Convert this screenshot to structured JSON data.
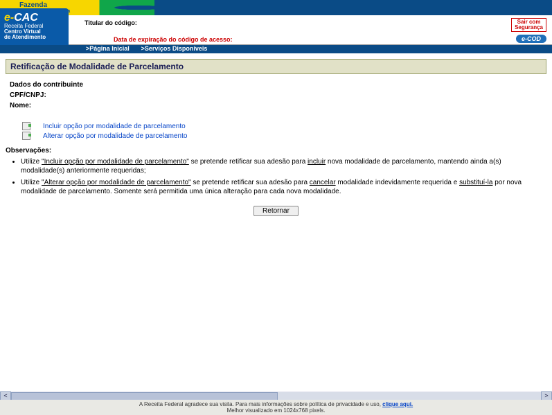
{
  "brand": {
    "name": "Fazenda",
    "sub": "Ministério da Fazenda"
  },
  "ecac": {
    "big_e": "e-",
    "big_rest": "CAC",
    "l1": "Receita Federal",
    "l2": "Centro Virtual",
    "l3": "de Atendimento"
  },
  "header": {
    "titular_label": "Titular do código:",
    "expira_label": "Data de expiração do código de acesso:",
    "sair_l1": "Sair com",
    "sair_l2": "Segurança",
    "ecod": "e-COD"
  },
  "nav": {
    "home": ">Página Inicial",
    "servicos": ">Serviços Disponíveis"
  },
  "page": {
    "title": "Retificação de Modalidade de Parcelamento",
    "dados_label": "Dados do contribuinte",
    "cpf_label": "CPF/CNPJ:",
    "nome_label": "Nome:"
  },
  "links": {
    "incluir": "Incluir opção por modalidade de parcelamento",
    "alterar": "Alterar opção por modalidade de parcelamento"
  },
  "obs": {
    "title": "Observações:",
    "l1_a": "Utilize ",
    "l1_q": "\"Incluir opção por modalidade de parcelamento\"",
    "l1_b": " se pretende retificar sua adesão para ",
    "l1_u": "incluir",
    "l1_c": " nova modalidade de parcelamento, mantendo ainda a(s) modalidade(s) anteriormente requeridas;",
    "l2_a": "Utilize ",
    "l2_q": "\"Alterar opção por modalidade de parcelamento\"",
    "l2_b": " se pretende retificar sua adesão para ",
    "l2_u1": "cancelar",
    "l2_c": " modalidade indevidamente requerida e ",
    "l2_u2": "substituí-la",
    "l2_d": " por nova modalidade de parcelamento. Somente será permitida uma única alteração para cada nova modalidade."
  },
  "button": {
    "retornar": "Retornar"
  },
  "footer": {
    "line1a": "A Receita Federal agradece sua visita. Para mais informações sobre política de privacidade e uso, ",
    "link": "clique aqui.",
    "line2": "Melhor visualizado em 1024x768 pixels."
  },
  "scroll": {
    "left": "<",
    "right": ">"
  }
}
